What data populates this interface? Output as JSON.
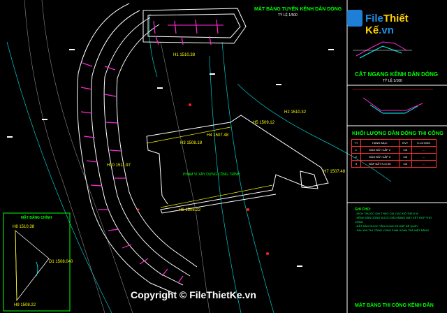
{
  "logo": {
    "text_a": "File",
    "text_b": "Thiết Kế",
    "text_c": ".vn"
  },
  "plan_title": "MẶT BẰNG TUYẾN KÊNH DẪN DÒNG",
  "plan_scale": "TỶ LỆ 1/500",
  "section_title": "CẮT NGANG KÊNH DẪN DÒNG",
  "section_scale": "TỶ LỆ 1/100",
  "quantity_title": "KHỐI LƯỢNG DẪN DÒNG THI CÔNG",
  "quantity_table": {
    "headers": [
      "TT",
      "HẠNG MỤC",
      "ĐVT",
      "K.LƯỢNG"
    ],
    "rows": [
      [
        "1",
        "ĐÀO ĐẤT CẤP 2",
        "m3",
        "..."
      ],
      [
        "2",
        "ĐÀO ĐẤT CẤP 3",
        "m3",
        "..."
      ],
      [
        "3",
        "ĐẮP ĐẤT K=0,95",
        "m3",
        "..."
      ]
    ]
  },
  "notes_title": "GHI CHÚ:",
  "notes": [
    "- KÍCH THƯỚC GHI THEO CM, CAO ĐỘ THEO M",
    "- KÊNH DẪN DÒNG ĐƯỢC ĐÀO BẰNG MÁY KẾT HỢP THỦ CÔNG",
    "- ĐẤT ĐÀO ĐƯỢC TẬN DỤNG ĐỂ ĐẮP ĐÊ QUÂY",
    "- SAU KHI THI CÔNG XONG PHẢI HOÀN TRẢ MẶT BẰNG"
  ],
  "work_area_label": "PHẠM VI XÂY DỰNG CÔNG TRÌNH",
  "inset_title": "MẶT BẰNG CHÍNH",
  "point_labels": [
    {
      "name": "H1",
      "elev": "1510.38"
    },
    {
      "name": "H2",
      "elev": "1510.32"
    },
    {
      "name": "H3",
      "elev": "1508.18"
    },
    {
      "name": "H4",
      "elev": "1507.48"
    },
    {
      "name": "H5",
      "elev": "1509.12"
    },
    {
      "name": "H6",
      "elev": "1508.22"
    },
    {
      "name": "H7",
      "elev": "1507.48"
    },
    {
      "name": "D1",
      "elev": "1508.040"
    },
    {
      "name": "H8",
      "elev": "1510.38"
    },
    {
      "name": "H9",
      "elev": "1508.22"
    },
    {
      "name": "H10",
      "elev": "1511.97"
    }
  ],
  "bottom_title": "MẶT BẰNG THI CÔNG KÊNH DẪN",
  "watermark": "Copyright © FileThietKe.vn",
  "colors": {
    "canal": "#ffffff",
    "hatch": "#ff2ad4",
    "contour": "#00ffff",
    "terrain": "#00ff00",
    "dims": "#ffff00",
    "table_border": "#ff3030"
  }
}
